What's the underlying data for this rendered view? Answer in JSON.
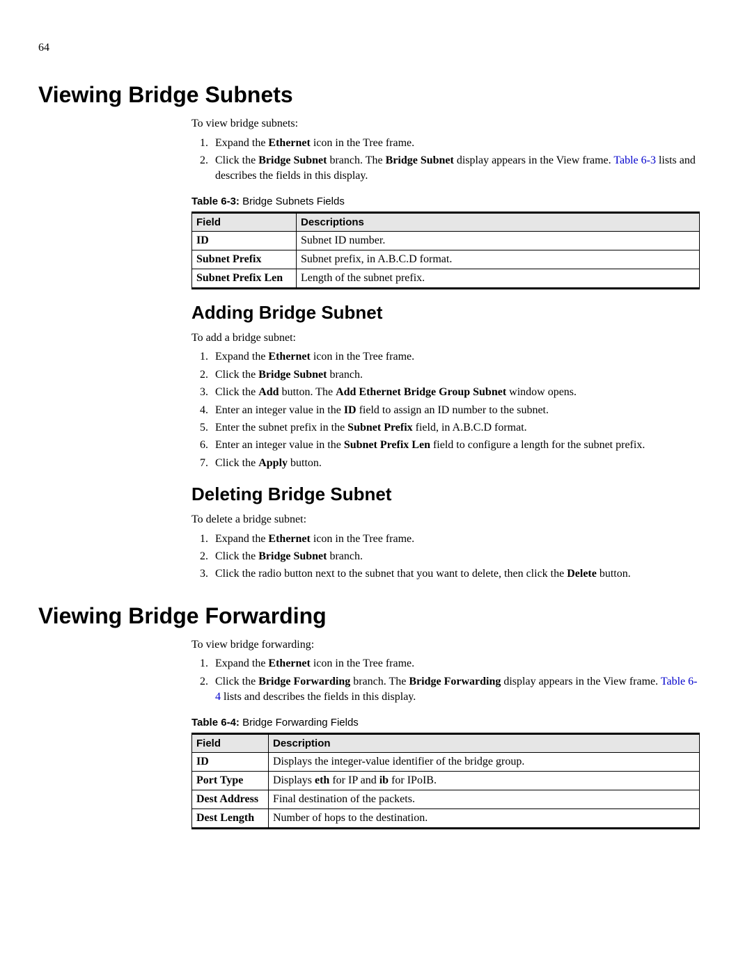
{
  "page_number": "64",
  "h1_subnets": "Viewing Bridge Subnets",
  "subnets_intro": "To view bridge subnets:",
  "subnets_steps": {
    "s1_pre": "Expand the ",
    "s1_b1": "Ethernet",
    "s1_post": " icon in the Tree frame.",
    "s2_pre": "Click the ",
    "s2_b1": "Bridge Subnet",
    "s2_mid": " branch. The ",
    "s2_b2": "Bridge Subnet",
    "s2_post1": " display appears in the View frame. ",
    "s2_link": "Table 6-3",
    "s2_post2": " lists and describes the fields in this display."
  },
  "table63_caption_b": "Table 6-3:",
  "table63_caption_t": " Bridge Subnets Fields",
  "table63_header_field": "Field",
  "table63_header_desc": "Descriptions",
  "table63_rows": [
    {
      "field": "ID",
      "desc": "Subnet ID number."
    },
    {
      "field": "Subnet Prefix",
      "desc": "Subnet prefix, in A.B.C.D format."
    },
    {
      "field": "Subnet Prefix Len",
      "desc": "Length of the subnet prefix."
    }
  ],
  "h2_add": "Adding Bridge Subnet",
  "add_intro": "To add a bridge subnet:",
  "add_steps": {
    "a1_pre": "Expand the ",
    "a1_b1": "Ethernet",
    "a1_post": " icon in the Tree frame.",
    "a2_pre": "Click the ",
    "a2_b1": "Bridge Subnet",
    "a2_post": " branch.",
    "a3_pre": "Click the ",
    "a3_b1": "Add",
    "a3_mid": " button. The ",
    "a3_b2": "Add Ethernet Bridge Group Subnet",
    "a3_post": " window opens.",
    "a4_pre": "Enter an integer value in the ",
    "a4_b1": "ID",
    "a4_post": " field to assign an ID number to the subnet.",
    "a5_pre": "Enter the subnet prefix in the ",
    "a5_b1": "Subnet Prefix",
    "a5_post": " field, in A.B.C.D format.",
    "a6_pre": "Enter an integer value in the ",
    "a6_b1": "Subnet Prefix Len",
    "a6_post": " field to configure a length for the subnet prefix.",
    "a7_pre": "Click the ",
    "a7_b1": "Apply",
    "a7_post": " button."
  },
  "h2_del": "Deleting Bridge Subnet",
  "del_intro": "To delete a bridge subnet:",
  "del_steps": {
    "d1_pre": "Expand the ",
    "d1_b1": "Ethernet",
    "d1_post": " icon in the Tree frame.",
    "d2_pre": "Click the ",
    "d2_b1": "Bridge Subnet",
    "d2_post": " branch.",
    "d3_pre": "Click the radio button next to the subnet that you want to delete, then click the ",
    "d3_b1": "Delete",
    "d3_post": " button."
  },
  "h1_fwd": "Viewing Bridge Forwarding",
  "fwd_intro": "To view bridge forwarding:",
  "fwd_steps": {
    "f1_pre": "Expand the ",
    "f1_b1": "Ethernet",
    "f1_post": " icon in the Tree frame.",
    "f2_pre": "Click the ",
    "f2_b1": "Bridge Forwarding",
    "f2_mid": " branch. The ",
    "f2_b2": "Bridge Forwarding",
    "f2_post1": " display appears in the View frame. ",
    "f2_link": "Table 6-4",
    "f2_post2": " lists and describes the fields in this display."
  },
  "table64_caption_b": "Table 6-4:",
  "table64_caption_t": " Bridge Forwarding Fields",
  "table64_header_field": "Field",
  "table64_header_desc": "Description",
  "table64_rows": [
    {
      "field": "ID",
      "desc_pre": "Displays the integer-value identifier of the bridge group.",
      "b1": "",
      "mid": "",
      "b2": "",
      "post": ""
    },
    {
      "field": "Port Type",
      "desc_pre": "Displays ",
      "b1": "eth",
      "mid": " for IP and ",
      "b2": "ib",
      "post": " for IPoIB."
    },
    {
      "field": "Dest Address",
      "desc_pre": "Final destination of the packets.",
      "b1": "",
      "mid": "",
      "b2": "",
      "post": ""
    },
    {
      "field": "Dest Length",
      "desc_pre": "Number of hops to the destination.",
      "b1": "",
      "mid": "",
      "b2": "",
      "post": ""
    }
  ]
}
